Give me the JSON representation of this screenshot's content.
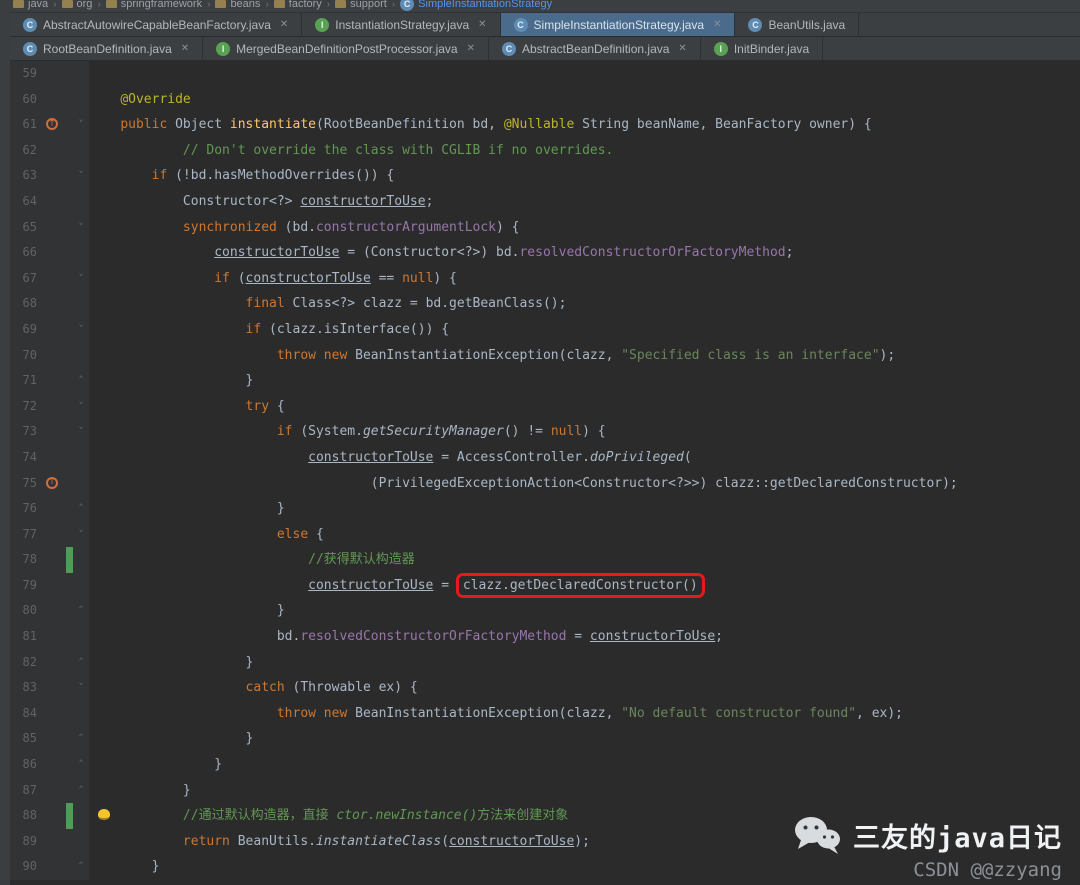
{
  "breadcrumb": {
    "items": [
      {
        "label": "java"
      },
      {
        "label": "org"
      },
      {
        "label": "springframework"
      },
      {
        "label": "beans"
      },
      {
        "label": "factory"
      },
      {
        "label": "support"
      }
    ],
    "current": {
      "label": "SimpleInstantiationStrategy"
    }
  },
  "tabs": {
    "row1": [
      {
        "label": "AbstractAutowireCapableBeanFactory.java",
        "kind": "class",
        "close": true,
        "active": false
      },
      {
        "label": "InstantiationStrategy.java",
        "kind": "interface",
        "close": true,
        "active": false
      },
      {
        "label": "SimpleInstantiationStrategy.java",
        "kind": "class",
        "close": true,
        "active": true
      },
      {
        "label": "BeanUtils.java",
        "kind": "class",
        "close": false,
        "active": false
      }
    ],
    "row2": [
      {
        "label": "RootBeanDefinition.java",
        "kind": "class",
        "close": true,
        "active": false
      },
      {
        "label": "MergedBeanDefinitionPostProcessor.java",
        "kind": "interface",
        "close": true,
        "active": false
      },
      {
        "label": "AbstractBeanDefinition.java",
        "kind": "class",
        "close": true,
        "active": false
      },
      {
        "label": "InitBinder.java",
        "kind": "interface",
        "close": false,
        "active": false
      }
    ]
  },
  "icons": {
    "fold_open": "˅",
    "fold_close": "˄",
    "close": "✕",
    "class_letter": "C",
    "interface_letter": "I",
    "override_arrow": "↑",
    "breadcrumb_separator": "›"
  },
  "colors": {
    "editor_bg": "#2b2b2b",
    "gutter_bg": "#313335",
    "tabbar_bg": "#3c3f41",
    "active_tab_bg": "#4a6b8c",
    "keyword": "#cc7832",
    "string": "#6a8759",
    "comment": "#629755",
    "field": "#9876aa",
    "method": "#ffc66b",
    "annotation": "#bbb529",
    "text": "#a9b7c6",
    "line_number": "#606366",
    "annotation_box": "#e8191c",
    "vcs_added": "#4b9e55",
    "class_icon": "#5e8cb3",
    "interface_icon": "#5aa253",
    "breadcrumb_current": "#5394ec",
    "watermark_text": "#f0f2f4",
    "watermark_sub": "#8b9198"
  },
  "editor": {
    "lines": [
      {
        "n": 59,
        "t": []
      },
      {
        "n": 60,
        "t": [
          [
            "d",
            "    "
          ],
          [
            "a",
            "@Override"
          ]
        ]
      },
      {
        "n": 61,
        "ovr": true,
        "fold": "open",
        "t": [
          [
            "d",
            "    "
          ],
          [
            "k",
            "public"
          ],
          [
            "d",
            " Object "
          ],
          [
            "m",
            "instantiate"
          ],
          [
            "d",
            "(RootBeanDefinition bd, "
          ],
          [
            "a",
            "@Nullable"
          ],
          [
            "d",
            " String beanName, BeanFactory owner) {"
          ]
        ]
      },
      {
        "n": 62,
        "t": [
          [
            "d",
            "            "
          ],
          [
            "c",
            "// Don't override the class with CGLIB if no overrides."
          ]
        ]
      },
      {
        "n": 63,
        "fold": "open",
        "t": [
          [
            "d",
            "        "
          ],
          [
            "k",
            "if"
          ],
          [
            "d",
            " (!bd.hasMethodOverrides()) {"
          ]
        ]
      },
      {
        "n": 64,
        "t": [
          [
            "d",
            "            Constructor<?> "
          ],
          [
            "u",
            "constructorToUse"
          ],
          [
            "d",
            ";"
          ]
        ]
      },
      {
        "n": 65,
        "fold": "open",
        "t": [
          [
            "d",
            "            "
          ],
          [
            "k",
            "synchronized"
          ],
          [
            "d",
            " (bd."
          ],
          [
            "f",
            "constructorArgumentLock"
          ],
          [
            "d",
            ") {"
          ]
        ]
      },
      {
        "n": 66,
        "t": [
          [
            "d",
            "                "
          ],
          [
            "u",
            "constructorToUse"
          ],
          [
            "d",
            " = (Constructor<?>) bd."
          ],
          [
            "f",
            "resolvedConstructorOrFactoryMethod"
          ],
          [
            "d",
            ";"
          ]
        ]
      },
      {
        "n": 67,
        "fold": "open",
        "t": [
          [
            "d",
            "                "
          ],
          [
            "k",
            "if"
          ],
          [
            "d",
            " ("
          ],
          [
            "u",
            "constructorToUse"
          ],
          [
            "d",
            " == "
          ],
          [
            "k",
            "null"
          ],
          [
            "d",
            ") {"
          ]
        ]
      },
      {
        "n": 68,
        "t": [
          [
            "d",
            "                    "
          ],
          [
            "k",
            "final"
          ],
          [
            "d",
            " Class<?> clazz = bd.getBeanClass();"
          ]
        ]
      },
      {
        "n": 69,
        "fold": "open",
        "t": [
          [
            "d",
            "                    "
          ],
          [
            "k",
            "if"
          ],
          [
            "d",
            " (clazz.isInterface()) {"
          ]
        ]
      },
      {
        "n": 70,
        "t": [
          [
            "d",
            "                        "
          ],
          [
            "k",
            "throw new"
          ],
          [
            "d",
            " BeanInstantiationException(clazz, "
          ],
          [
            "s",
            "\"Specified class is an interface\""
          ],
          [
            "d",
            ");"
          ]
        ]
      },
      {
        "n": 71,
        "fold": "close",
        "t": [
          [
            "d",
            "                    }"
          ]
        ]
      },
      {
        "n": 72,
        "fold": "open",
        "t": [
          [
            "d",
            "                    "
          ],
          [
            "k",
            "try"
          ],
          [
            "d",
            " {"
          ]
        ]
      },
      {
        "n": 73,
        "fold": "open",
        "t": [
          [
            "d",
            "                        "
          ],
          [
            "k",
            "if"
          ],
          [
            "d",
            " (System."
          ],
          [
            "i",
            "getSecurityManager"
          ],
          [
            "d",
            "() != "
          ],
          [
            "k",
            "null"
          ],
          [
            "d",
            ") {"
          ]
        ]
      },
      {
        "n": 74,
        "t": [
          [
            "d",
            "                            "
          ],
          [
            "u",
            "constructorToUse"
          ],
          [
            "d",
            " = AccessController."
          ],
          [
            "i",
            "doPrivileged"
          ],
          [
            "d",
            "("
          ]
        ]
      },
      {
        "n": 75,
        "ovr": true,
        "t": [
          [
            "d",
            "                                    (PrivilegedExceptionAction<Constructor<?>>) clazz::getDeclaredConstructor);"
          ]
        ]
      },
      {
        "n": 76,
        "fold": "close",
        "t": [
          [
            "d",
            "                        }"
          ]
        ]
      },
      {
        "n": 77,
        "fold": "open",
        "t": [
          [
            "d",
            "                        "
          ],
          [
            "k",
            "else"
          ],
          [
            "d",
            " {"
          ]
        ]
      },
      {
        "n": 78,
        "vcs": true,
        "t": [
          [
            "d",
            "                            "
          ],
          [
            "c",
            "//获得默认构造器"
          ]
        ]
      },
      {
        "n": 79,
        "t": [
          [
            "d",
            "                            "
          ],
          [
            "u",
            "constructorToUse"
          ],
          [
            "d",
            " = "
          ],
          [
            "box",
            "clazz.getDeclaredConstructor()"
          ]
        ]
      },
      {
        "n": 80,
        "fold": "close",
        "t": [
          [
            "d",
            "                        }"
          ]
        ]
      },
      {
        "n": 81,
        "t": [
          [
            "d",
            "                        bd."
          ],
          [
            "f",
            "resolvedConstructorOrFactoryMethod"
          ],
          [
            "d",
            " = "
          ],
          [
            "u",
            "constructorToUse"
          ],
          [
            "d",
            ";"
          ]
        ]
      },
      {
        "n": 82,
        "fold": "close",
        "t": [
          [
            "d",
            "                    }"
          ]
        ]
      },
      {
        "n": 83,
        "fold": "open",
        "t": [
          [
            "d",
            "                    "
          ],
          [
            "k",
            "catch"
          ],
          [
            "d",
            " (Throwable ex) {"
          ]
        ]
      },
      {
        "n": 84,
        "t": [
          [
            "d",
            "                        "
          ],
          [
            "k",
            "throw new"
          ],
          [
            "d",
            " BeanInstantiationException(clazz, "
          ],
          [
            "s",
            "\"No default constructor found\""
          ],
          [
            "d",
            ", ex);"
          ]
        ]
      },
      {
        "n": 85,
        "fold": "close",
        "t": [
          [
            "d",
            "                    }"
          ]
        ]
      },
      {
        "n": 86,
        "fold": "close",
        "t": [
          [
            "d",
            "                }"
          ]
        ]
      },
      {
        "n": 87,
        "fold": "close",
        "t": [
          [
            "d",
            "            }"
          ]
        ]
      },
      {
        "n": 88,
        "vcs": true,
        "bulb": true,
        "t": [
          [
            "d",
            "            "
          ],
          [
            "c",
            "//通过默认构造器，直接 "
          ],
          [
            "ci",
            "ctor.newInstance()"
          ],
          [
            "c",
            "方法来创建对象"
          ]
        ]
      },
      {
        "n": 89,
        "t": [
          [
            "d",
            "            "
          ],
          [
            "k",
            "return"
          ],
          [
            "d",
            " BeanUtils."
          ],
          [
            "i",
            "instantiateClass"
          ],
          [
            "d",
            "("
          ],
          [
            "u",
            "constructorToUse"
          ],
          [
            "d",
            ");"
          ]
        ]
      },
      {
        "n": 90,
        "fold": "close",
        "t": [
          [
            "d",
            "        }"
          ]
        ]
      }
    ]
  },
  "watermark": {
    "title": "三友的java日记",
    "subtitle": "CSDN @@zzyang"
  }
}
